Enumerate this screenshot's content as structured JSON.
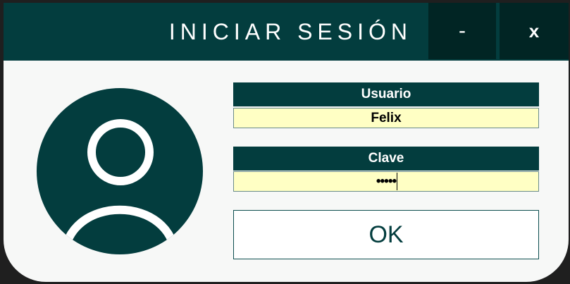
{
  "window": {
    "title": "INICIAR SESIÓN",
    "minimize_label": "-",
    "close_label": "x"
  },
  "user_field": {
    "label": "Usuario",
    "value": "Felix"
  },
  "password_field": {
    "label": "Clave",
    "masked_value": "•••••"
  },
  "ok_button": {
    "label": "OK"
  },
  "colors": {
    "title_bar": "#033d3e",
    "window_buttons": "#012524",
    "input_background": "#ffffc4",
    "body_background": "#f7f8f7"
  },
  "icons": {
    "avatar": "user-avatar-icon"
  }
}
